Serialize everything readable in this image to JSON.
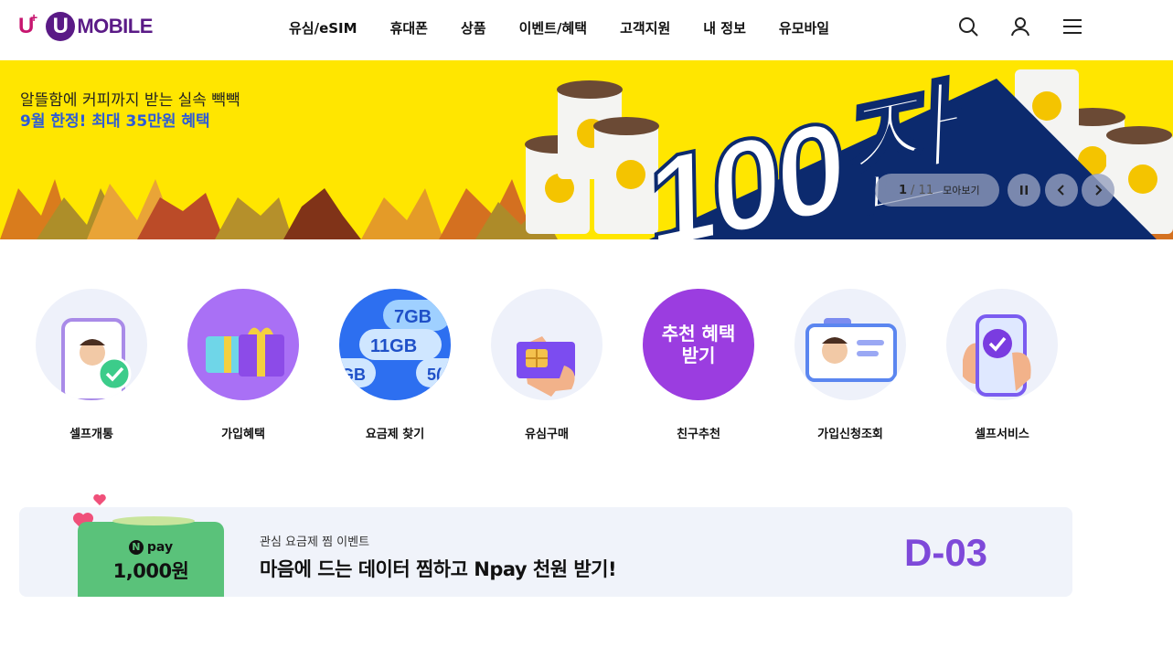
{
  "header": {
    "logo": {
      "uplus": "U",
      "plus": "+",
      "u": "U",
      "mobile": "MOBILE"
    },
    "nav": [
      "유심/eSIM",
      "휴대폰",
      "상품",
      "이벤트/혜택",
      "고객지원",
      "내 정보",
      "유모바일"
    ],
    "icons": [
      "search-icon",
      "user-icon",
      "menu-icon"
    ]
  },
  "banner": {
    "subtitle": "알뜰함에 커피까지 받는 실속 빽빽",
    "headline": "9월 한정! 최대 35만원 혜택",
    "big_text": "100잔",
    "pager": {
      "current": "1",
      "total": "/ 11",
      "more_label": "모아보기"
    },
    "colors": {
      "background": "#ffe600",
      "accent": "#0c2a6e",
      "headline": "#2c5bd8"
    }
  },
  "quick_menu": {
    "items": [
      {
        "label": "셀프개통",
        "icon": "self-activation-icon"
      },
      {
        "label": "가입혜택",
        "icon": "gift-icon"
      },
      {
        "label": "요금제 찾기",
        "icon": "data-plan-icon",
        "chips": [
          "7GB",
          "11GB",
          "GB",
          "5("
        ]
      },
      {
        "label": "유심구매",
        "icon": "sim-card-icon"
      },
      {
        "label": "친구추천",
        "icon_text_line1": "추천 혜택",
        "icon_text_line2": "받기"
      },
      {
        "label": "가입신청조회",
        "icon": "id-card-icon"
      },
      {
        "label": "셀프서비스",
        "icon": "phone-check-icon"
      }
    ]
  },
  "event": {
    "npay_brand": "pay",
    "npay_n": "N",
    "npay_amount": "1,000원",
    "subtitle": "관심 요금제 찜 이벤트",
    "title": "마음에 드는 데이터 찜하고 Npay 천원 받기!",
    "dday": "D-03",
    "colors": {
      "dday": "#7e49d9",
      "card": "#f0f3fa",
      "npay": "#5ac27a"
    }
  }
}
